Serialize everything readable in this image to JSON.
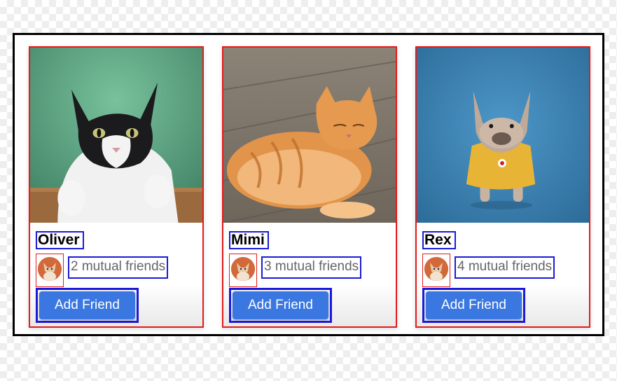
{
  "cards": [
    {
      "name": "Oliver",
      "mutual": "2 mutual friends",
      "button": "Add Friend",
      "photo": "tuxedo-cat-photo"
    },
    {
      "name": "Mimi",
      "mutual": "3 mutual friends",
      "button": "Add Friend",
      "photo": "orange-tabby-cat-photo"
    },
    {
      "name": "Rex",
      "mutual": "4 mutual friends",
      "button": "Add Friend",
      "photo": "french-bulldog-photo"
    }
  ],
  "colors": {
    "button_bg": "#3a77e0",
    "button_text": "#ffffff",
    "card_outline": "#e31b1b",
    "text_outline": "#1a1adb",
    "mutual_text": "#666666"
  }
}
